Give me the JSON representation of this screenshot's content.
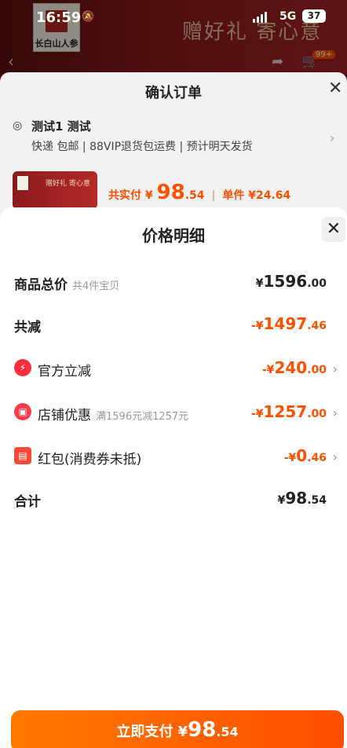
{
  "status_bar": {
    "time": "16:59",
    "network": "5G",
    "battery": "37"
  },
  "background_page": {
    "brand_name": "长白山人参",
    "slogan": "赠好礼 寄心意",
    "cart_badge": "99+"
  },
  "order_sheet": {
    "title": "确认订单",
    "address": {
      "name": "测试1 测试",
      "detail": "快递 包邮 | 88VIP退货包运费 | 预计明天发货"
    },
    "product": {
      "thumb_text": "赠好礼 寄心意"
    },
    "pay_summary": {
      "label": "共实付",
      "currency": "¥",
      "amount_int": "98",
      "amount_dec": ".54",
      "unit_label": "单件",
      "unit_price": "¥24.64"
    }
  },
  "price_detail": {
    "title": "价格明细",
    "rows": [
      {
        "label": "商品总价",
        "sub": "共4件宝贝",
        "currency": "¥",
        "int": "1596",
        "dec": ".00"
      },
      {
        "label": "共减",
        "sub": "",
        "currency": "-¥",
        "int": "1497",
        "dec": ".46"
      },
      {
        "label": "官方立减",
        "sub": "",
        "currency": "-¥",
        "int": "240",
        "dec": ".00"
      },
      {
        "label": "店铺优惠",
        "sub": "满1596元减1257元",
        "currency": "-¥",
        "int": "1257",
        "dec": ".00"
      },
      {
        "label": "红包(消费券未抵)",
        "sub": "",
        "currency": "-¥",
        "int": "0",
        "dec": ".46"
      },
      {
        "label": "合计",
        "sub": "",
        "currency": "¥",
        "int": "98",
        "dec": ".54"
      }
    ]
  },
  "pay_button": {
    "label": "立即支付",
    "currency": "¥",
    "int": "98",
    "dec": ".54"
  },
  "colors": {
    "accent": "#ff5000",
    "button_start": "#ff7a00",
    "button_end": "#ff4e00"
  }
}
